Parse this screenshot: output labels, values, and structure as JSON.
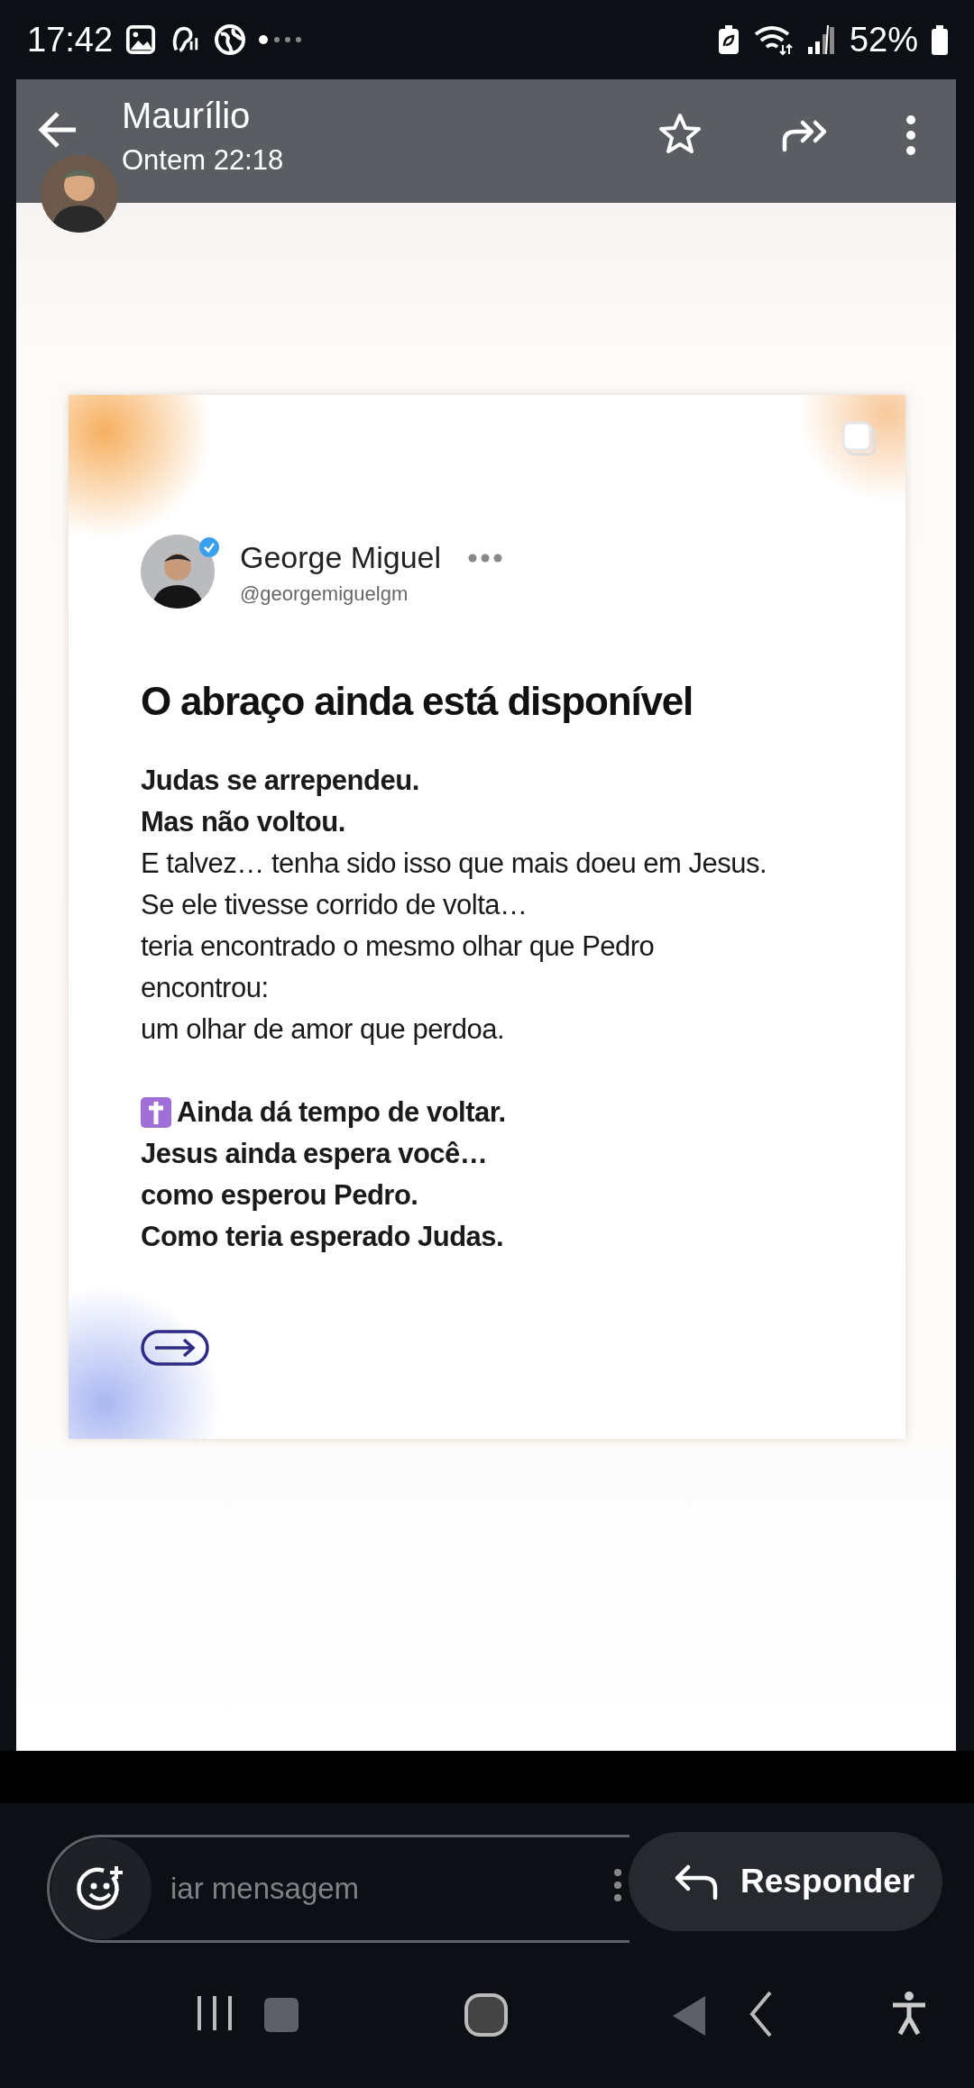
{
  "status_bar": {
    "time": "17:42",
    "battery": "52%"
  },
  "header": {
    "name": "Maurílio",
    "subtitle": "Ontem 22:18"
  },
  "post": {
    "author": "George Miguel",
    "handle": "@georgemiguelgm",
    "verified": true,
    "title": "O abraço ainda está disponível",
    "paragraphs": [
      {
        "lines": [
          {
            "kind": "text",
            "text": "Judas se arrependeu.",
            "bold": true
          },
          {
            "kind": "text",
            "text": "Mas não voltou.",
            "bold": true
          },
          {
            "kind": "text",
            "text": "E talvez… tenha sido isso que mais doeu em Jesus.",
            "bold": false
          },
          {
            "kind": "text",
            "text": "Se ele tivesse corrido de volta…",
            "bold": false
          },
          {
            "kind": "text",
            "text": "teria encontrado o mesmo olhar que Pedro",
            "bold": false
          },
          {
            "kind": "text",
            "text": "encontrou:",
            "bold": false
          },
          {
            "kind": "text",
            "text": "um olhar de amor que perdoa.",
            "bold": false
          }
        ]
      },
      {
        "lines": [
          {
            "kind": "cross",
            "text": "Ainda dá tempo de voltar.",
            "bold": true
          },
          {
            "kind": "text",
            "text": "Jesus ainda espera você…",
            "bold": true
          },
          {
            "kind": "text",
            "text": "como esperou Pedro.",
            "bold": true
          },
          {
            "kind": "text",
            "text": "Como teria esperado Judas.",
            "bold": true
          }
        ]
      }
    ]
  },
  "reply": {
    "placeholder": "iar mensagem",
    "button": "Responder"
  }
}
